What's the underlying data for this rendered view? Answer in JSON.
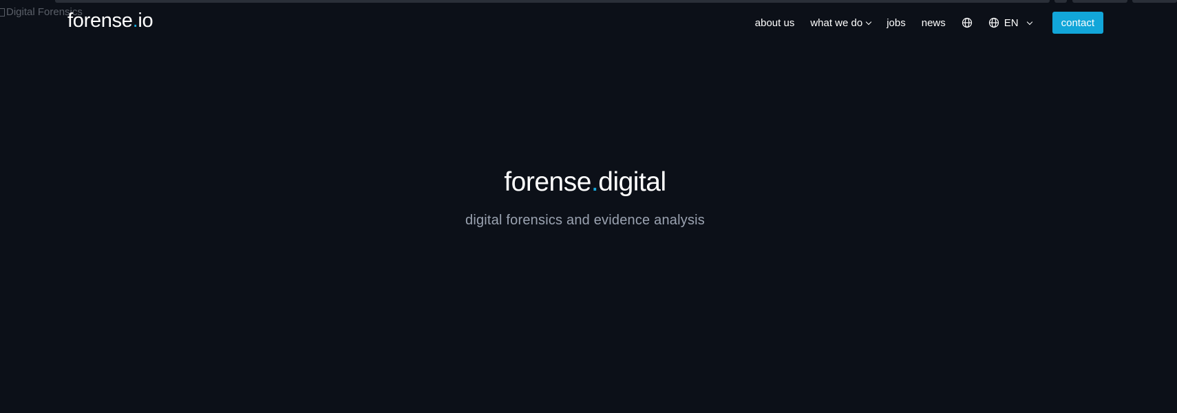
{
  "broken_image_alt": "Digital Forensics",
  "logo": {
    "name": "forense",
    "dot": ".",
    "tld": "io"
  },
  "nav": {
    "items": [
      {
        "label": "about us"
      },
      {
        "label": "what we do"
      },
      {
        "label": "jobs"
      },
      {
        "label": "news"
      }
    ],
    "language": "EN",
    "contact_label": "contact"
  },
  "hero": {
    "title_name": "forense",
    "title_dot": ".",
    "title_tld": "digital",
    "subtitle": "digital forensics and evidence analysis"
  },
  "colors": {
    "background": "#0c1018",
    "accent": "#12a6d9",
    "subtitle": "#9ba3b1"
  },
  "icons": [
    "globe-icon",
    "chevron-down-icon"
  ]
}
